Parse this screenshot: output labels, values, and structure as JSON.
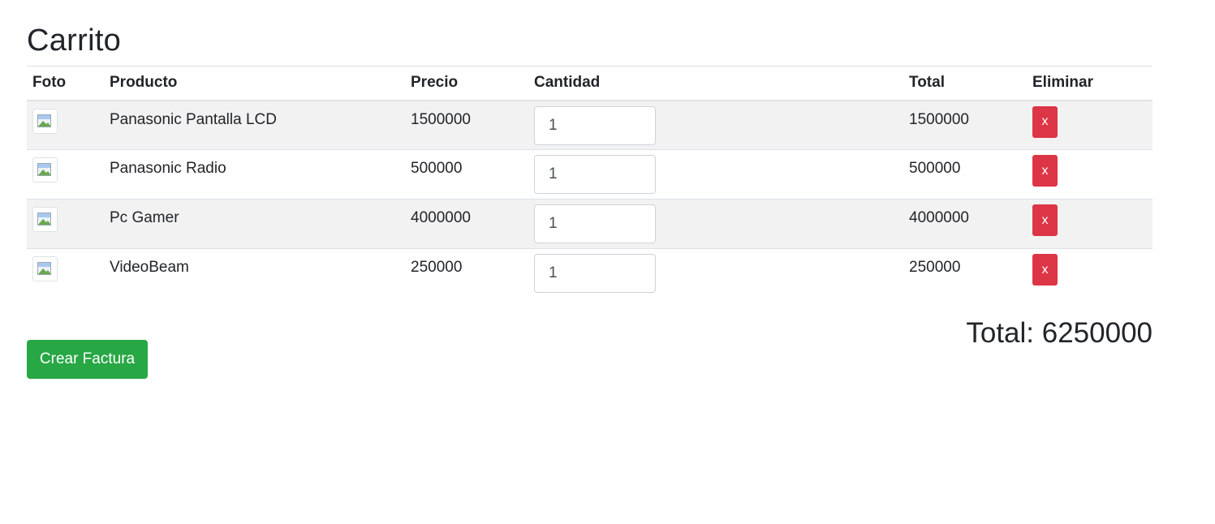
{
  "page": {
    "title": "Carrito"
  },
  "table": {
    "headers": {
      "foto": "Foto",
      "producto": "Producto",
      "precio": "Precio",
      "cantidad": "Cantidad",
      "total": "Total",
      "eliminar": "Eliminar"
    },
    "rows": [
      {
        "image_icon": "broken-image-icon",
        "producto": "Panasonic Pantalla LCD",
        "precio": "1500000",
        "cantidad": "1",
        "total": "1500000",
        "eliminar": "x"
      },
      {
        "image_icon": "broken-image-icon",
        "producto": "Panasonic Radio",
        "precio": "500000",
        "cantidad": "1",
        "total": "500000",
        "eliminar": "x"
      },
      {
        "image_icon": "broken-image-icon",
        "producto": "Pc Gamer",
        "precio": "4000000",
        "cantidad": "1",
        "total": "4000000",
        "eliminar": "x"
      },
      {
        "image_icon": "broken-image-icon",
        "producto": "VideoBeam",
        "precio": "250000",
        "cantidad": "1",
        "total": "250000",
        "eliminar": "x"
      }
    ]
  },
  "summary": {
    "total_label": "Total: 6250000"
  },
  "actions": {
    "create_invoice": "Crear Factura"
  },
  "colors": {
    "danger": "#dc3545",
    "success": "#28a745",
    "stripe": "#f2f2f2"
  }
}
